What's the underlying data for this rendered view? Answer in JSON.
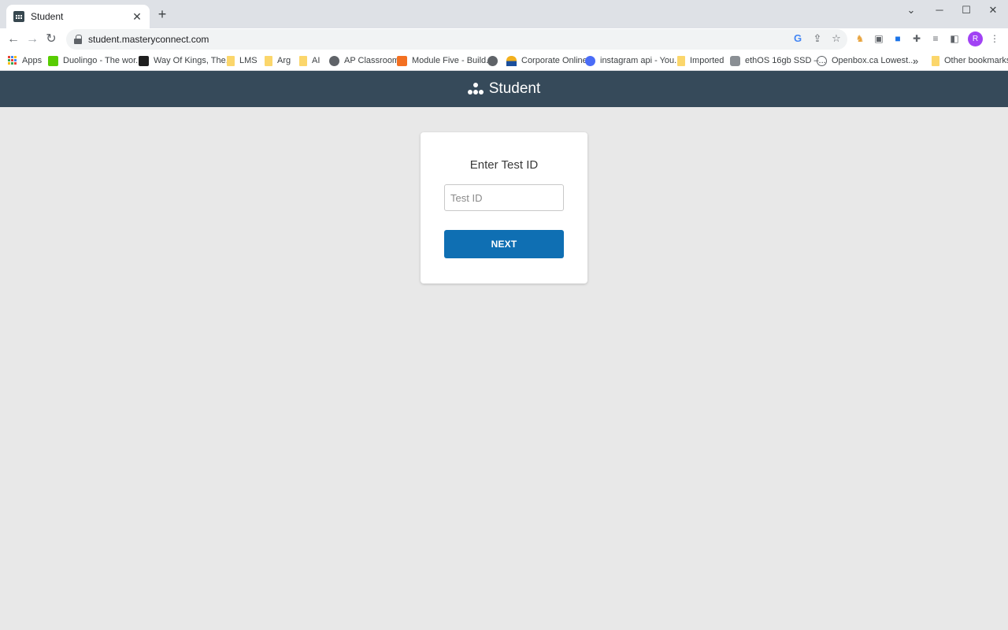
{
  "browser": {
    "tab_title": "Student",
    "tab_close": "✕",
    "new_tab": "+",
    "url": "student.masteryconnect.com",
    "window_controls": {
      "minimize": "─",
      "maximize": "☐",
      "close": "✕",
      "tab_search": "⌄"
    },
    "avatar_letter": "R",
    "bookmarks": [
      {
        "label": "Apps",
        "icon": "apps-grid-icon"
      },
      {
        "label": "Duolingo - The wor...",
        "icon": "duolingo-icon"
      },
      {
        "label": "Way Of Kings, The...",
        "icon": "book-icon"
      },
      {
        "label": "LMS",
        "icon": "folder-icon"
      },
      {
        "label": "Arg",
        "icon": "folder-icon"
      },
      {
        "label": "AI",
        "icon": "folder-icon"
      },
      {
        "label": "AP Classroom",
        "icon": "globe-icon"
      },
      {
        "label": "Module Five - Build...",
        "icon": "cube-icon"
      },
      {
        "label": "",
        "icon": "globe-icon"
      },
      {
        "label": "Corporate Online",
        "icon": "bank-icon"
      },
      {
        "label": "instagram api - You...",
        "icon": "circle-icon"
      },
      {
        "label": "Imported",
        "icon": "folder-icon"
      },
      {
        "label": "ethOS 16gb SSD –...",
        "icon": "drive-icon"
      },
      {
        "label": "Openbox.ca Lowest...",
        "icon": "openbox-icon"
      }
    ],
    "more_bookmarks": "»",
    "other_bookmarks": "Other bookmarks"
  },
  "app": {
    "brand": "Student",
    "card_title": "Enter Test ID",
    "input_placeholder": "Test ID",
    "input_value": "",
    "next_label": "NEXT"
  },
  "colors": {
    "header": "#364a5a",
    "button": "#0f6fb3",
    "background": "#e8e8e8"
  }
}
